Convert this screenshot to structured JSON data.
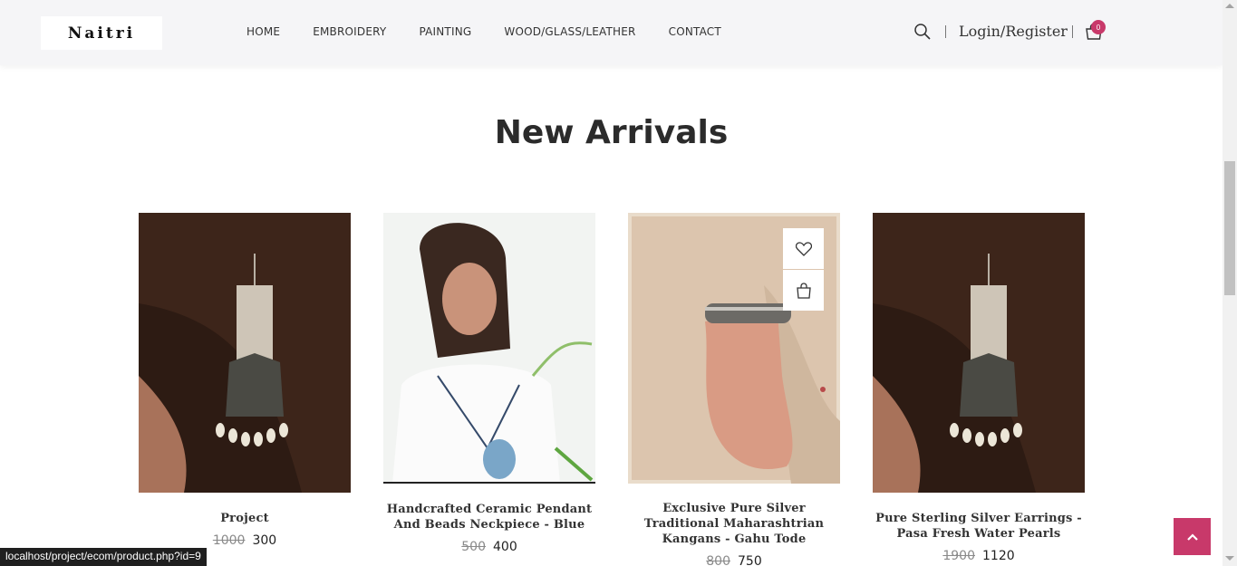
{
  "header": {
    "logo_text": "Naitri",
    "nav": [
      "HOME",
      "EMBROIDERY",
      "PAINTING",
      "WOOD/GLASS/LEATHER",
      "CONTACT"
    ],
    "login_label": "Login/Register",
    "cart_count": "0"
  },
  "section": {
    "title": "New Arrivals"
  },
  "products": [
    {
      "name": "Project",
      "old_price": "1000",
      "price": "300"
    },
    {
      "name": "Handcrafted Ceramic Pendant And Beads Neckpiece - Blue",
      "old_price": "500",
      "price": "400"
    },
    {
      "name": "Exclusive Pure Silver Traditional Maharashtrian Kangans - Gahu Tode",
      "old_price": "800",
      "price": "750"
    },
    {
      "name": "Pure Sterling Silver Earrings - Pasa Fresh Water Pearls",
      "old_price": "1900",
      "price": "1120"
    }
  ],
  "status_url": "localhost/project/ecom/product.php?id=9",
  "colors": {
    "accent": "#c8396a",
    "header_bg": "#f5f5f7",
    "title": "#2b2b2b"
  },
  "icons": {
    "search": "search-icon",
    "cart": "cart-icon",
    "wishlist": "heart-icon",
    "add_to_cart": "shopping-bag-icon",
    "back_to_top": "chevron-up-icon"
  }
}
